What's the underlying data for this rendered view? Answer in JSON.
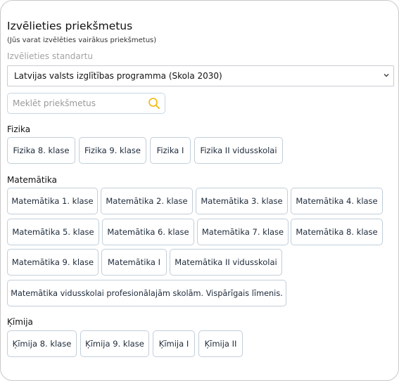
{
  "header": {
    "title": "Izvēlieties priekšmetus",
    "subtitle": "(Jūs varat izvēlēties vairākus priekšmetus)"
  },
  "standard": {
    "label": "Izvēlieties standartu",
    "selected": "Latvijas valsts izglītības programma (Skola 2030)"
  },
  "search": {
    "placeholder": "Meklēt priekšmetus",
    "value": ""
  },
  "categories": [
    {
      "name": "Fizika",
      "subjects": [
        "Fizika 8. klase",
        "Fizika 9. klase",
        "Fizika I",
        "Fizika II vidusskolai"
      ]
    },
    {
      "name": "Matemātika",
      "subjects": [
        "Matemātika 1. klase",
        "Matemātika 2. klase",
        "Matemātika 3. klase",
        "Matemātika 4. klase",
        "Matemātika 5. klase",
        "Matemātika 6. klase",
        "Matemātika 7. klase",
        "Matemātika 8. klase",
        "Matemātika 9. klase",
        "Matemātika I",
        "Matemātika II vidusskolai",
        "Matemātika vidusskolai profesionālajām skolām. Vispārīgais līmenis."
      ]
    },
    {
      "name": "Ķīmija",
      "subjects": [
        "Ķīmija 8. klase",
        "Ķīmija 9. klase",
        "Ķīmija I",
        "Ķīmija II"
      ]
    }
  ],
  "colors": {
    "chip_border": "#c2ced9",
    "search_icon": "#f2b705",
    "label_gray": "#a3a3a3"
  },
  "icons": {
    "search": "magnifier-icon",
    "select": "chevron-down-icon"
  }
}
